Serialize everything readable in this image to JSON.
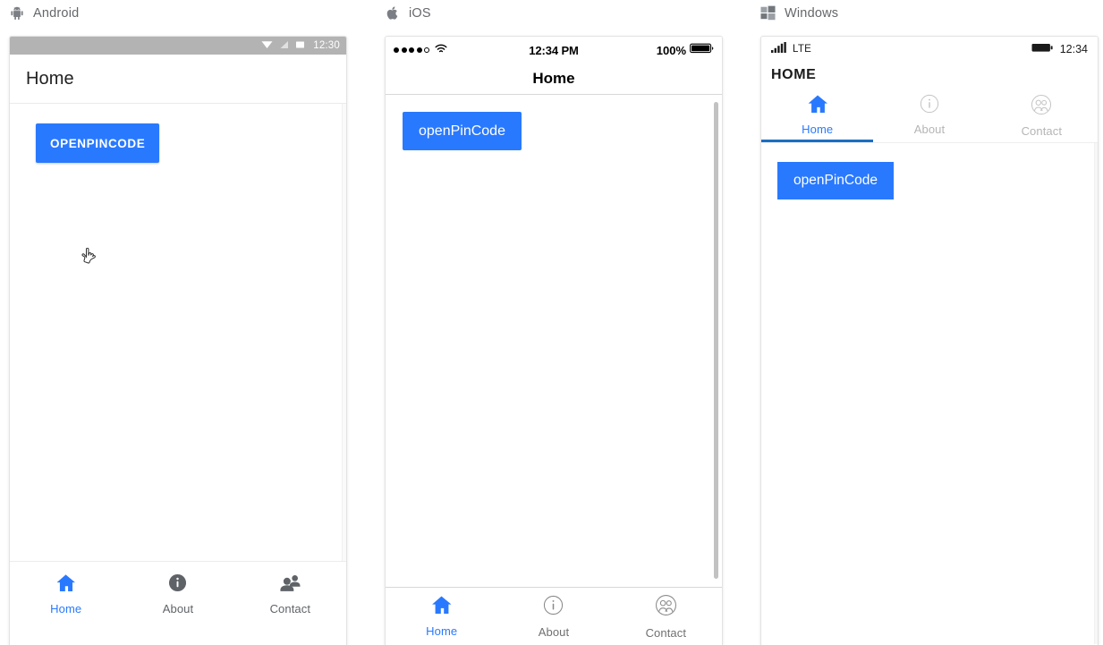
{
  "platforms": [
    {
      "key": "android",
      "label": "Android",
      "icon": "android-robot-icon",
      "status_bar": {
        "time": "12:30",
        "icons": [
          "wifi-icon",
          "signal-icon",
          "battery-icon"
        ]
      },
      "header_title": "Home",
      "button_label": "OPENPINCODE",
      "nav": [
        {
          "label": "Home",
          "icon": "home-icon",
          "active": true
        },
        {
          "label": "About",
          "icon": "info-icon",
          "active": false
        },
        {
          "label": "Contact",
          "icon": "contacts-icon",
          "active": false
        }
      ],
      "cursor": "pointer-hand-cursor"
    },
    {
      "key": "ios",
      "label": "iOS",
      "icon": "apple-logo-icon",
      "status_bar": {
        "signal_dots_filled": 4,
        "signal_dots_hollow": 1,
        "wifi": "wifi-icon",
        "time": "12:34 PM",
        "battery_percent": "100%",
        "battery": "battery-icon"
      },
      "header_title": "Home",
      "button_label": "openPinCode",
      "nav": [
        {
          "label": "Home",
          "icon": "home-icon",
          "active": true
        },
        {
          "label": "About",
          "icon": "info-outline-icon",
          "active": false
        },
        {
          "label": "Contact",
          "icon": "contacts-outline-icon",
          "active": false
        }
      ]
    },
    {
      "key": "windows",
      "label": "Windows",
      "icon": "windows-logo-icon",
      "status_bar": {
        "signal": "signal-bars-icon",
        "network": "LTE",
        "battery": "battery-icon",
        "time": "12:34"
      },
      "header_title": "HOME",
      "button_label": "openPinCode",
      "nav": [
        {
          "label": "Home",
          "icon": "home-icon",
          "active": true
        },
        {
          "label": "About",
          "icon": "info-outline-icon",
          "active": false
        },
        {
          "label": "Contact",
          "icon": "contacts-outline-icon",
          "active": false
        }
      ]
    }
  ],
  "colors": {
    "accent_blue": "#2979ff",
    "windows_underline": "#1b6ec2",
    "android_status_bar": "#b3b3b3",
    "inactive_text": "#5f6368"
  }
}
